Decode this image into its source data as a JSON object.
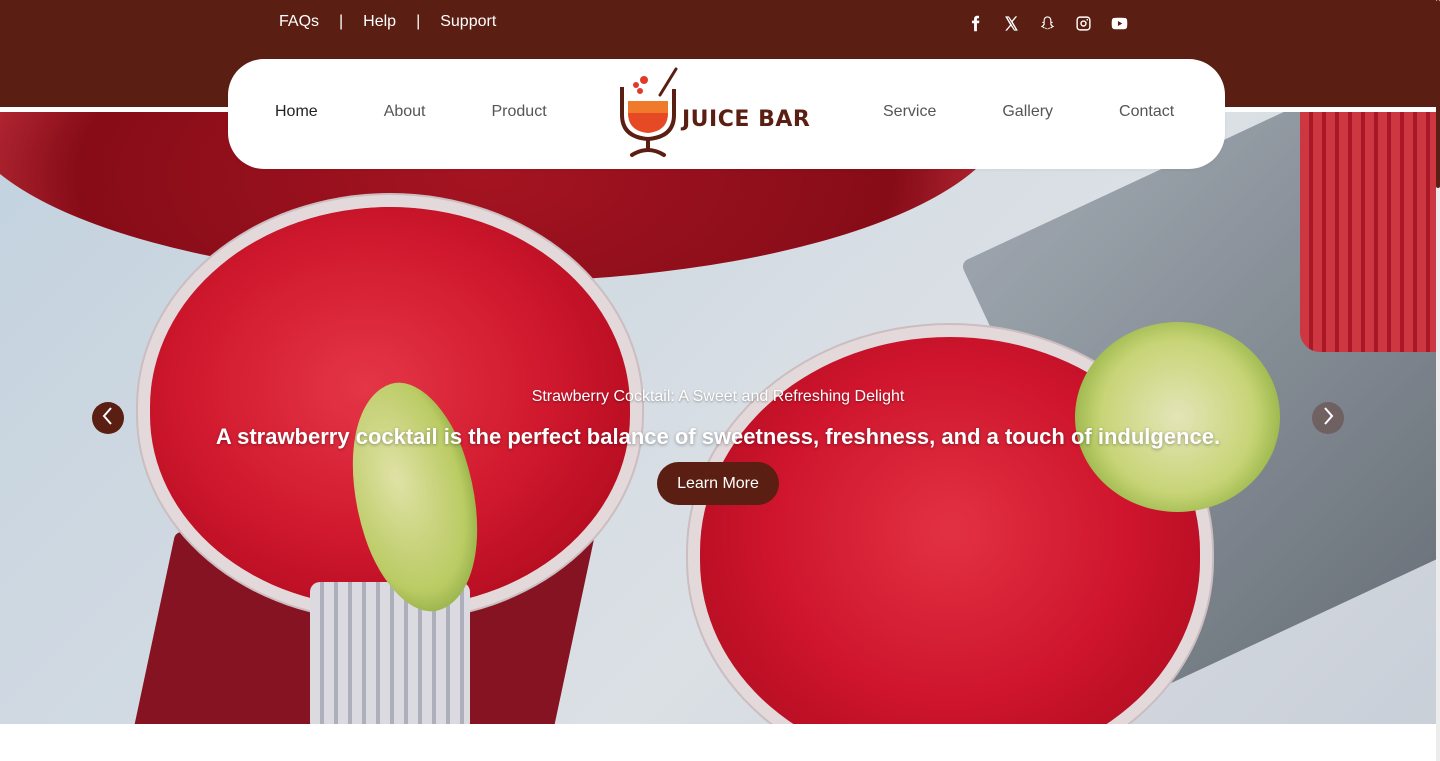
{
  "topbar": {
    "links": [
      "FAQs",
      "Help",
      "Support"
    ],
    "separator": "|",
    "social_icons": [
      "facebook-icon",
      "x-icon",
      "snapchat-icon",
      "instagram-icon",
      "youtube-icon"
    ]
  },
  "nav": {
    "left": [
      "Home",
      "About",
      "Product"
    ],
    "right": [
      "Service",
      "Gallery",
      "Contact"
    ],
    "active": "Home"
  },
  "logo": {
    "text": "JUICE BAR"
  },
  "hero": {
    "subtitle": "Strawberry Cocktail: A Sweet and Refreshing Delight",
    "title": "A strawberry cocktail is the perfect balance of sweetness, freshness, and a touch of indulgence.",
    "button": "Learn More"
  },
  "colors": {
    "brand": "#5a1f12",
    "white": "#ffffff"
  }
}
